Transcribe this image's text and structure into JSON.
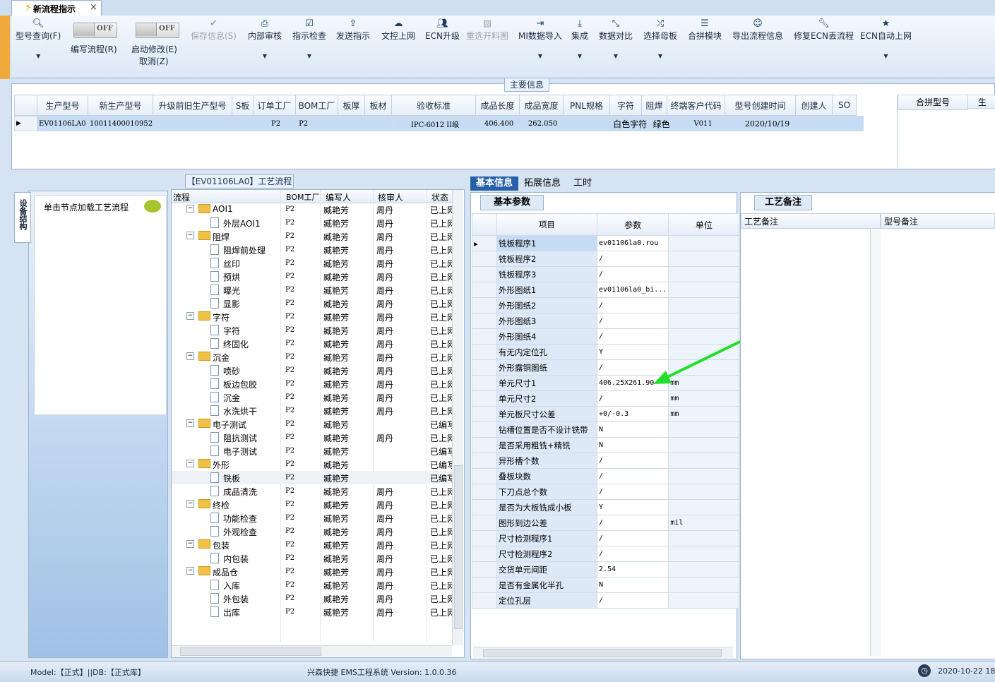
{
  "window": {
    "tab_title": "新流程指示",
    "close": "×"
  },
  "toolbar": {
    "query": "型号查询(F)",
    "write_flow": "编写流程(R)",
    "edit_enable": "启动修改(E)",
    "cancel": "取消(Z)",
    "toggle_text": "OFF",
    "save": "保存信息(S)",
    "internal_review": "内部审核",
    "instruction_check": "指示检查",
    "send_instruction": "发送指示",
    "doc_upload": "文控上网",
    "ecn_upgrade": "ECN升级",
    "reselect_drawing": "重选开料图",
    "mi_import": "MI数据导入",
    "integrate": "集成",
    "data_compare": "数据对比",
    "select_master": "选择母板",
    "merge_module": "合拼模块",
    "export_flow": "导出流程信息",
    "fix_ecn": "修复ECN丢流程",
    "ecn_auto": "ECN自动上网"
  },
  "main_info": {
    "label": "主要信息",
    "columns": [
      "生产型号",
      "新生产型号",
      "升级前旧生产型号",
      "S板",
      "订单工厂",
      "BOM工厂",
      "板厚",
      "板材",
      "验收标准",
      "成品长度",
      "成品宽度",
      "PNL规格",
      "字符",
      "阻焊",
      "终端客户代码",
      "型号创建时间",
      "创建人",
      "SO"
    ],
    "row": [
      "EV01106LA0",
      "10011400010952",
      "",
      "",
      "P2",
      "P2",
      "",
      "",
      "IPC-6012 II级",
      "406.400",
      "262.050",
      "",
      "白色字符",
      "绿色",
      "V011",
      "2020/10/19",
      "",
      ""
    ],
    "side_columns": [
      "合拼型号",
      "生"
    ]
  },
  "tree_panel": {
    "side_tab": "设备结构",
    "load_hint": "单击节点加载工艺流程",
    "title": "【EV01106LA0】工艺流程",
    "columns": [
      "流程",
      "BOM工厂",
      "编写人",
      "核审人",
      "状态"
    ],
    "rows": [
      {
        "name": "AOI1",
        "level": 0,
        "bom": "P2",
        "writer": "臧艳芳",
        "reviewer": "周丹",
        "status": "已上网"
      },
      {
        "name": "外层AOI1",
        "level": 1,
        "bom": "P2",
        "writer": "臧艳芳",
        "reviewer": "周丹",
        "status": "已上网"
      },
      {
        "name": "阻焊",
        "level": 0,
        "bom": "P2",
        "writer": "臧艳芳",
        "reviewer": "周丹",
        "status": "已上网"
      },
      {
        "name": "阻焊前处理",
        "level": 1,
        "bom": "P2",
        "writer": "臧艳芳",
        "reviewer": "周丹",
        "status": "已上网"
      },
      {
        "name": "丝印",
        "level": 1,
        "bom": "P2",
        "writer": "臧艳芳",
        "reviewer": "周丹",
        "status": "已上网"
      },
      {
        "name": "预烘",
        "level": 1,
        "bom": "P2",
        "writer": "臧艳芳",
        "reviewer": "周丹",
        "status": "已上网"
      },
      {
        "name": "曝光",
        "level": 1,
        "bom": "P2",
        "writer": "臧艳芳",
        "reviewer": "周丹",
        "status": "已上网"
      },
      {
        "name": "显影",
        "level": 1,
        "bom": "P2",
        "writer": "臧艳芳",
        "reviewer": "周丹",
        "status": "已上网"
      },
      {
        "name": "字符",
        "level": 0,
        "bom": "P2",
        "writer": "臧艳芳",
        "reviewer": "周丹",
        "status": "已上网"
      },
      {
        "name": "字符",
        "level": 1,
        "bom": "P2",
        "writer": "臧艳芳",
        "reviewer": "周丹",
        "status": "已上网"
      },
      {
        "name": "终固化",
        "level": 1,
        "bom": "P2",
        "writer": "臧艳芳",
        "reviewer": "周丹",
        "status": "已上网"
      },
      {
        "name": "沉金",
        "level": 0,
        "bom": "P2",
        "writer": "臧艳芳",
        "reviewer": "周丹",
        "status": "已上网"
      },
      {
        "name": "喷砂",
        "level": 1,
        "bom": "P2",
        "writer": "臧艳芳",
        "reviewer": "周丹",
        "status": "已上网"
      },
      {
        "name": "板边包胶",
        "level": 1,
        "bom": "P2",
        "writer": "臧艳芳",
        "reviewer": "周丹",
        "status": "已上网"
      },
      {
        "name": "沉金",
        "level": 1,
        "bom": "P2",
        "writer": "臧艳芳",
        "reviewer": "周丹",
        "status": "已上网"
      },
      {
        "name": "水洗烘干",
        "level": 1,
        "bom": "P2",
        "writer": "臧艳芳",
        "reviewer": "周丹",
        "status": "已上网"
      },
      {
        "name": "电子测试",
        "level": 0,
        "bom": "P2",
        "writer": "臧艳芳",
        "reviewer": "",
        "status": "已编写"
      },
      {
        "name": "阻抗测试",
        "level": 1,
        "bom": "P2",
        "writer": "臧艳芳",
        "reviewer": "周丹",
        "status": "已上网"
      },
      {
        "name": "电子测试",
        "level": 1,
        "bom": "P2",
        "writer": "臧艳芳",
        "reviewer": "",
        "status": "已编写"
      },
      {
        "name": "外形",
        "level": 0,
        "bom": "P2",
        "writer": "臧艳芳",
        "reviewer": "",
        "status": "已编写"
      },
      {
        "name": "铣板",
        "level": 1,
        "bom": "P2",
        "writer": "臧艳芳",
        "reviewer": "",
        "status": "已编写",
        "selected": true
      },
      {
        "name": "成品清洗",
        "level": 1,
        "bom": "P2",
        "writer": "臧艳芳",
        "reviewer": "周丹",
        "status": "已上网"
      },
      {
        "name": "终检",
        "level": 0,
        "bom": "P2",
        "writer": "臧艳芳",
        "reviewer": "周丹",
        "status": "已上网"
      },
      {
        "name": "功能检查",
        "level": 1,
        "bom": "P2",
        "writer": "臧艳芳",
        "reviewer": "周丹",
        "status": "已上网"
      },
      {
        "name": "外观检查",
        "level": 1,
        "bom": "P2",
        "writer": "臧艳芳",
        "reviewer": "周丹",
        "status": "已上网"
      },
      {
        "name": "包装",
        "level": 0,
        "bom": "P2",
        "writer": "臧艳芳",
        "reviewer": "周丹",
        "status": "已上网"
      },
      {
        "name": "内包装",
        "level": 1,
        "bom": "P2",
        "writer": "臧艳芳",
        "reviewer": "周丹",
        "status": "已上网"
      },
      {
        "name": "成品仓",
        "level": 0,
        "bom": "P2",
        "writer": "臧艳芳",
        "reviewer": "周丹",
        "status": "已上网"
      },
      {
        "name": "入库",
        "level": 1,
        "bom": "P2",
        "writer": "臧艳芳",
        "reviewer": "周丹",
        "status": "已上网"
      },
      {
        "name": "外包装",
        "level": 1,
        "bom": "P2",
        "writer": "臧艳芳",
        "reviewer": "周丹",
        "status": "已上网"
      },
      {
        "name": "出库",
        "level": 1,
        "bom": "P2",
        "writer": "臧艳芳",
        "reviewer": "周丹",
        "status": "已上网"
      }
    ]
  },
  "right_tabs": {
    "basic": "基本信息",
    "extended": "拓展信息",
    "hours": "工时"
  },
  "params": {
    "tab": "基本参数",
    "columns": [
      "项目",
      "参数",
      "单位"
    ],
    "rows": [
      {
        "item": "铣板程序1",
        "value": "ev01106la0.rou",
        "unit": ""
      },
      {
        "item": "铣板程序2",
        "value": "/",
        "unit": ""
      },
      {
        "item": "铣板程序3",
        "value": "/",
        "unit": ""
      },
      {
        "item": "外形图纸1",
        "value": "ev01106la0_bi...",
        "unit": ""
      },
      {
        "item": "外形图纸2",
        "value": "/",
        "unit": ""
      },
      {
        "item": "外形图纸3",
        "value": "/",
        "unit": ""
      },
      {
        "item": "外形图纸4",
        "value": "/",
        "unit": ""
      },
      {
        "item": "有无内定位孔",
        "value": "Y",
        "unit": ""
      },
      {
        "item": "外形露铜图纸",
        "value": "/",
        "unit": ""
      },
      {
        "item": "单元尺寸1",
        "value": "406.25X261.90",
        "unit": "mm"
      },
      {
        "item": "单元尺寸2",
        "value": "/",
        "unit": "mm"
      },
      {
        "item": "单元板尺寸公差",
        "value": "+0/-0.3",
        "unit": "mm"
      },
      {
        "item": "钻槽位置是否不设计铣带",
        "value": "N",
        "unit": ""
      },
      {
        "item": "是否采用粗铣+精铣",
        "value": "N",
        "unit": ""
      },
      {
        "item": "异形槽个数",
        "value": "/",
        "unit": ""
      },
      {
        "item": "叠板块数",
        "value": "/",
        "unit": ""
      },
      {
        "item": "下刀点总个数",
        "value": "/",
        "unit": ""
      },
      {
        "item": "是否为大板铣成小板",
        "value": "Y",
        "unit": ""
      },
      {
        "item": "图形到边公差",
        "value": "/",
        "unit": "mil"
      },
      {
        "item": "尺寸检测程序1",
        "value": "/",
        "unit": ""
      },
      {
        "item": "尺寸检测程序2",
        "value": "/",
        "unit": ""
      },
      {
        "item": "交货单元间距",
        "value": "2.54",
        "unit": ""
      },
      {
        "item": "是否有金属化半孔",
        "value": "N",
        "unit": ""
      },
      {
        "item": "定位孔层",
        "value": "/",
        "unit": ""
      }
    ]
  },
  "notes": {
    "tab": "工艺备注",
    "col1": "工艺备注",
    "col2": "型号备注"
  },
  "status_bar": {
    "model": "Model:【正式】||DB:【正式库】",
    "system": "兴森快捷 EMS工程系统 Version: 1.0.0.36",
    "datetime": "2020-10-22 18"
  },
  "colors": {
    "accent": "#2560a8",
    "annotation_arrow": "#22e02a",
    "selection": "#c6dcf4"
  }
}
